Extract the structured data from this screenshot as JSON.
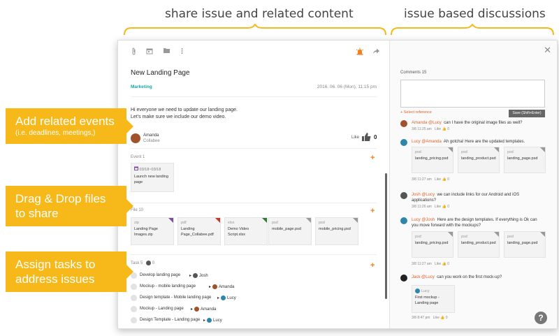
{
  "headers": {
    "left": "share issue and related content",
    "right": "issue based discussions"
  },
  "callouts": [
    {
      "main": "Add related events",
      "sub": "(i.e. deadlines, meetings,)"
    },
    {
      "main": "Drag & Drop files to share",
      "sub": ""
    },
    {
      "main": "Assign tasks to address issues",
      "sub": ""
    }
  ],
  "issue": {
    "title": "New Landing Page",
    "tag": "Marketing",
    "date": "2016. 06. 06 (Mon), 11:15 pm",
    "body_line1": "Hi everyone we need to update our landing page.",
    "body_line2": "Let's make sure we include our demo video.",
    "author_name": "Amanda",
    "author_role": "Collabee",
    "like_label": "Like",
    "like_count": "0"
  },
  "events": {
    "label": "Event 1",
    "items": [
      {
        "date": "03/18~03/18",
        "title": "Launch new landing page"
      }
    ]
  },
  "files": {
    "label": "File 10",
    "items": [
      {
        "ext": "zip",
        "name": "Landing Page Images.zip",
        "color": "#7b4fa0"
      },
      {
        "ext": "pdf",
        "name": "Landing Page_Collabee.pdf",
        "color": "#c0392b"
      },
      {
        "ext": "xlsx",
        "name": "Demo Video Script.xlsx",
        "color": "#2e7d32"
      },
      {
        "ext": "psd",
        "name": "mobile_page.psd",
        "color": "#999999"
      },
      {
        "ext": "psd",
        "name": "mobile_pricing.psd",
        "color": "#999999"
      }
    ]
  },
  "tasks": {
    "label": "Task 5",
    "done_count": "0",
    "items": [
      {
        "label": "Develop landing page",
        "assignee": "Josh",
        "av": "#555555"
      },
      {
        "label": "Mockup - mobile landing page",
        "assignee": "Amanda",
        "av": "#a0522d"
      },
      {
        "label": "Design template - Mobile landing page",
        "assignee": "Lucy",
        "av": "#2e86ab"
      },
      {
        "label": "Mockup - Landing page",
        "assignee": "Amanda",
        "av": "#a0522d"
      },
      {
        "label": "Design Template - Landing page",
        "assignee": "Lucy",
        "av": "#2e86ab"
      }
    ]
  },
  "comments": {
    "label": "Comments 15",
    "select_reference": "+ Select reference",
    "save_label": "Save (Shift+Enter)",
    "like_label": "Like",
    "c1": {
      "author": "Amanda @Lucy",
      "text": "can I have the original image files as well?",
      "time": "3/8 11:25 am",
      "likes": "0"
    },
    "c2": {
      "author": "Lucy @Amanda",
      "text": "Ah gotcha! Here are the updated templates.",
      "time": "3/8 11:27 am",
      "likes": "0",
      "files": [
        {
          "ext": "psd",
          "name": "landing_pricing.psd"
        },
        {
          "ext": "psd",
          "name": "landing_product.psd"
        },
        {
          "ext": "psd",
          "name": "landing_page.psd"
        }
      ]
    },
    "c3": {
      "author": "Josh @Lucy",
      "text": "we can include links for our Android and iOS applications?",
      "time": "3/8 11:26 am",
      "likes": "0"
    },
    "c4": {
      "author": "Lucy @Josh",
      "text": "Here are the design templates.  If everything is Ok can you move forward with the mockups?",
      "time": "3/8 11:27 am",
      "likes": "0",
      "files": [
        {
          "ext": "psd",
          "name": "landing_pricing.psd"
        },
        {
          "ext": "psd",
          "name": "landing_product.psd"
        },
        {
          "ext": "psd",
          "name": "landing_page.psd"
        }
      ]
    },
    "c5": {
      "author": "Jack @Lucy",
      "text": "can you work on the first mock-up?",
      "time": "3/8 8:47 pm",
      "likes": "0",
      "reply_user": "Lucy",
      "reply_title": "First mockup - Landing page"
    }
  },
  "colors": {
    "accent": "#f7b81a",
    "orange": "#f08020",
    "teal": "#1aa3a3"
  }
}
